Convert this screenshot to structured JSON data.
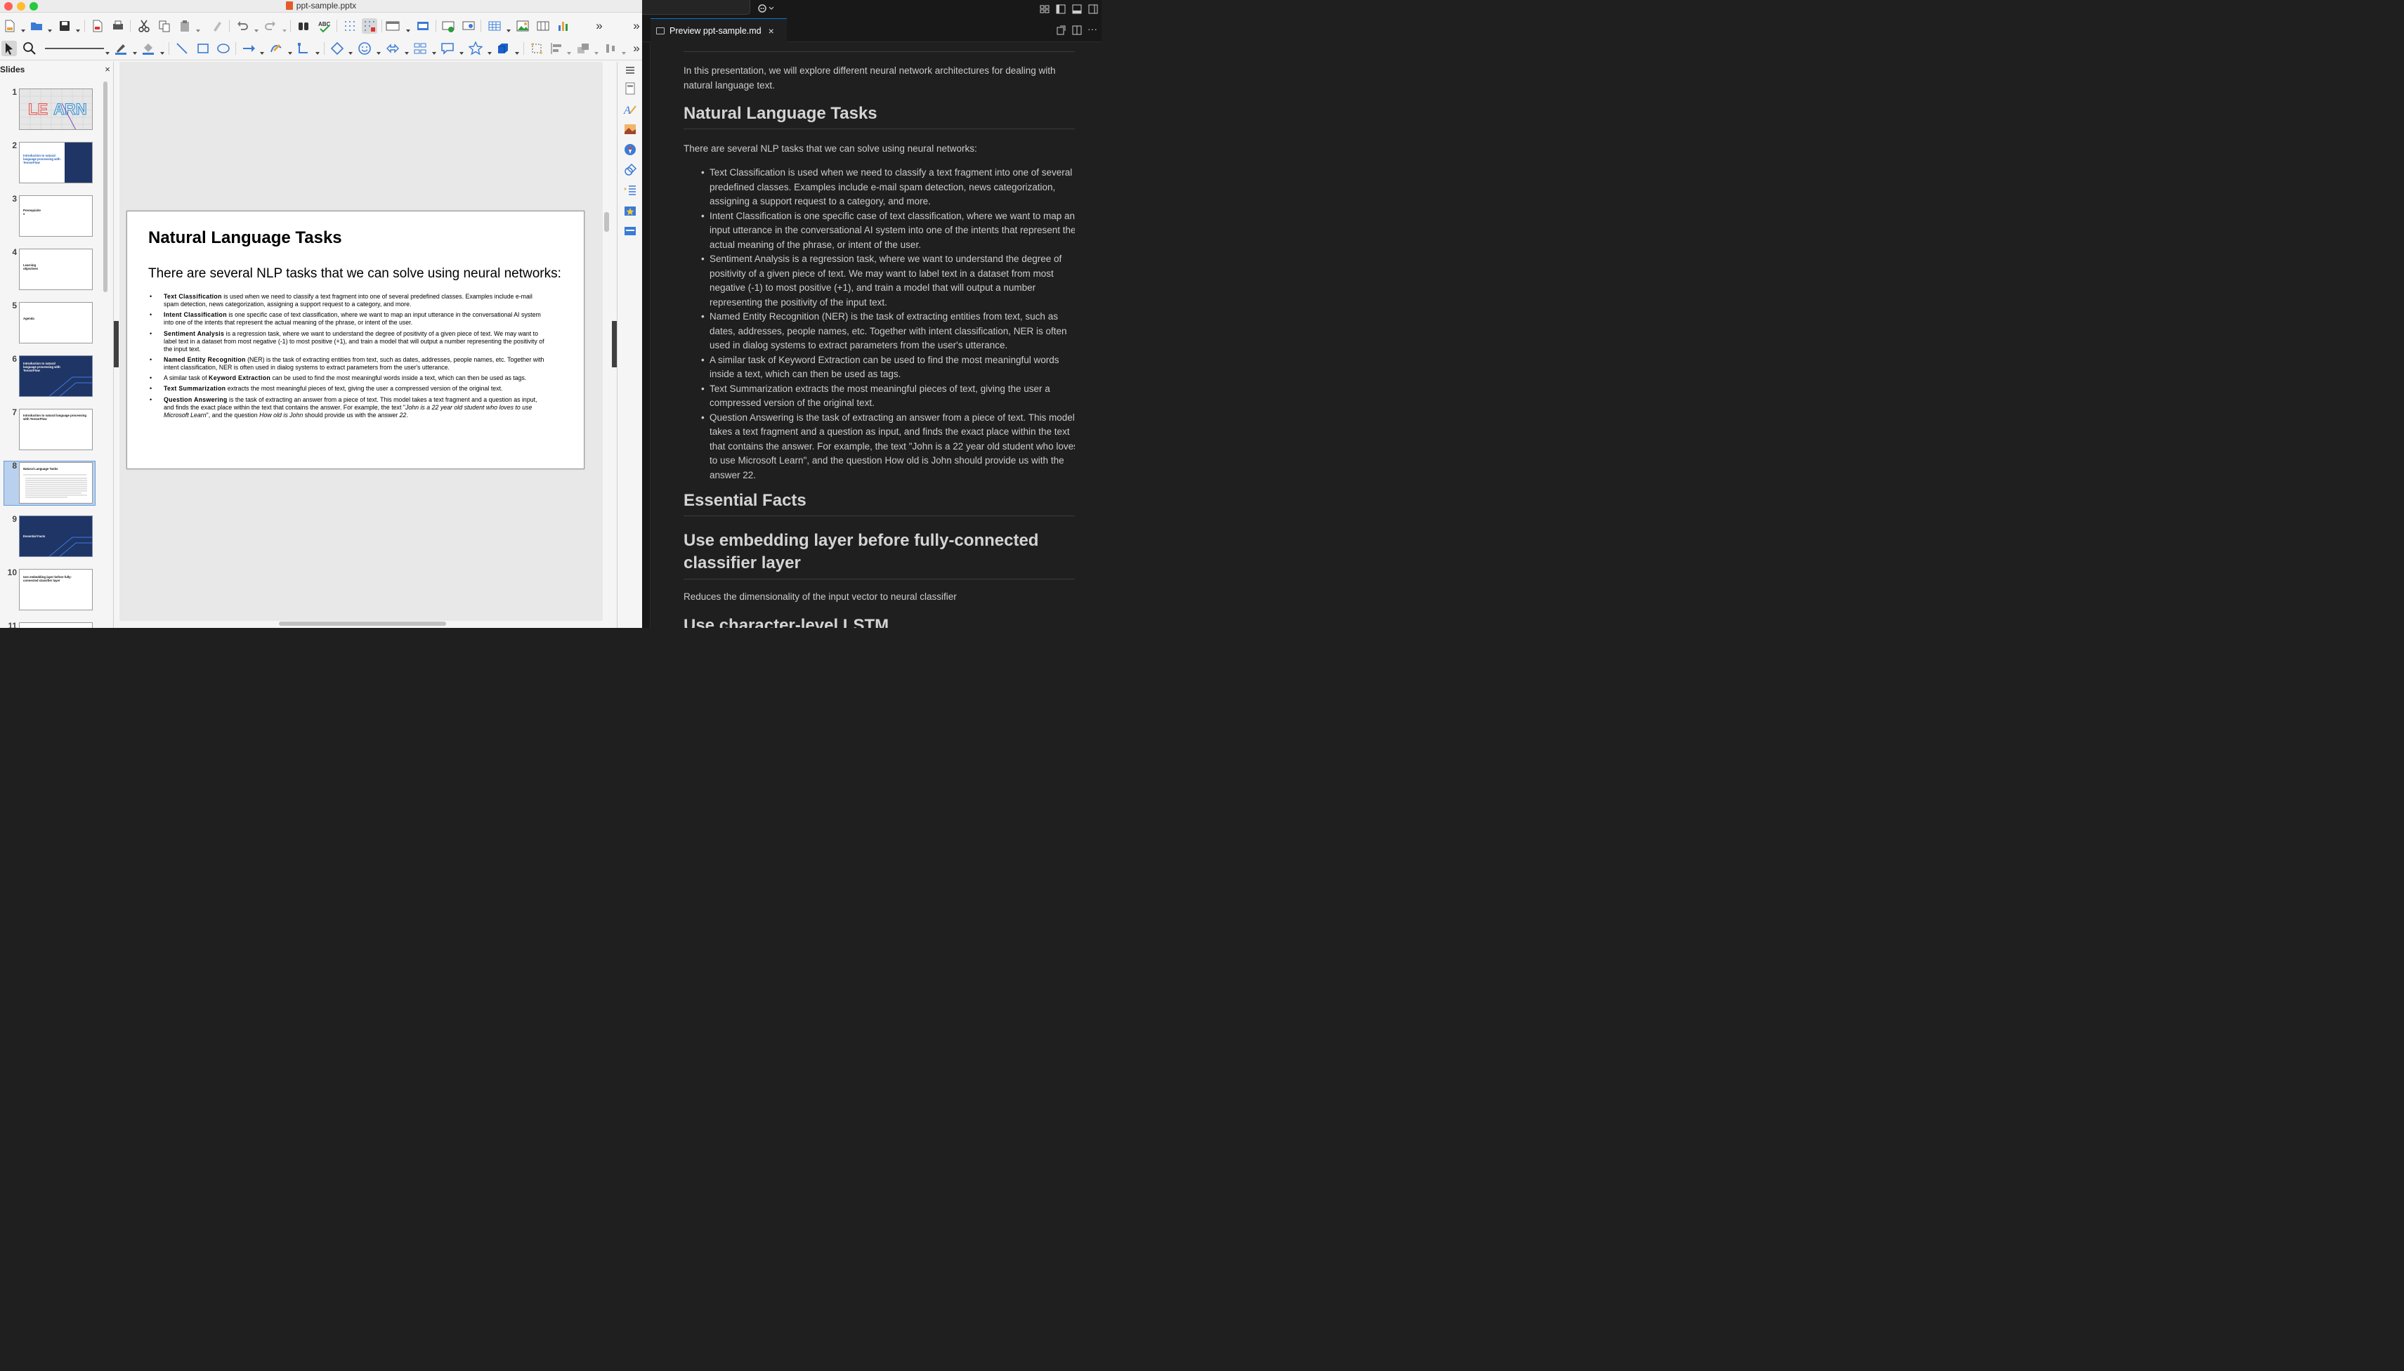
{
  "impress": {
    "window_title": "ppt-sample.pptx",
    "slides_pane_title": "Slides",
    "slides_pane_close": "×",
    "thumbnails": [
      {
        "num": "1",
        "title": "LEARN",
        "text": ""
      },
      {
        "num": "2",
        "title": "Introduction to natural language processing with TensorFlow",
        "text": ""
      },
      {
        "num": "3",
        "title": "Prerequisite s",
        "text": ""
      },
      {
        "num": "4",
        "title": "Learning objectives",
        "text": ""
      },
      {
        "num": "5",
        "title": "Agenda",
        "text": ""
      },
      {
        "num": "6",
        "title": "Introduction to natural language processing with TensorFlow",
        "text": ""
      },
      {
        "num": "7",
        "title": "Introduction to natural language processing with TensorFlow",
        "text": ""
      },
      {
        "num": "8",
        "title": "Natural Language Tasks",
        "text": ""
      },
      {
        "num": "9",
        "title": "Essential Facts",
        "text": ""
      },
      {
        "num": "10",
        "title": "Use embedding layer before fully-connected classifier layer",
        "text": ""
      },
      {
        "num": "11",
        "title": "",
        "text": ""
      }
    ],
    "slide": {
      "title": "Natural Language Tasks",
      "subtitle": "There are several NLP tasks that we can solve using neural networks:",
      "bullets": [
        {
          "bold": "Text Classification",
          "rest": " is used when we need to classify a text fragment into one of several predefined classes. Examples include e-mail spam detection, news categorization, assigning a support request to a category, and more."
        },
        {
          "bold": "Intent Classification",
          "rest": " is one specific case of text classification, where we want to map an input utterance in the conversational AI system into one of the intents that represent the actual meaning of the phrase, or intent of the user."
        },
        {
          "bold": "Sentiment Analysis",
          "rest": " is a regression task, where we want to understand the degree of positivity of a given piece of text. We may want to label text in a dataset from most negative (-1) to most positive (+1), and train a model that will output a number representing the positivity of the input text."
        },
        {
          "bold": "Named Entity Recognition",
          "rest": " (NER) is the task of extracting entities from text, such as dates, addresses, people names, etc. Together with intent classification, NER is often used in dialog systems to extract parameters from the user's utterance."
        },
        {
          "pre": "A similar task of ",
          "bold": "Keyword Extraction",
          "rest": " can be used to find the most meaningful words inside a text, which can then be used as tags."
        },
        {
          "bold": "Text Summarization",
          "rest": " extracts the most meaningful pieces of text, giving the user a compressed version of the original text."
        },
        {
          "bold": "Question Answering",
          "rest": " is the task of extracting an answer from a piece of text. This model takes a text fragment and a question as input, and finds the exact place within the text that contains the answer. For example, the text \"",
          "i1": "John is a 22 year old student who loves to use Microsoft Learn",
          "mid": "\", and the question ",
          "i2": "How old is John",
          "mid2": " should provide us with the answer ",
          "i3": "22",
          "end": "."
        }
      ]
    }
  },
  "vscode": {
    "tab_label": "Preview ppt-sample.md",
    "tab_close": "×",
    "preview": {
      "intro": "In this presentation, we will explore different neural network architectures for dealing with natural language text.",
      "h_nlt": "Natural Language Tasks",
      "p_nlt": "There are several NLP tasks that we can solve using neural networks:",
      "items": [
        "Text Classification is used when we need to classify a text fragment into one of several predefined classes. Examples include e-mail spam detection, news categorization, assigning a support request to a category, and more.",
        "Intent Classification is one specific case of text classification, where we want to map an input utterance in the conversational AI system into one of the intents that represent the actual meaning of the phrase, or intent of the user.",
        "Sentiment Analysis is a regression task, where we want to understand the degree of positivity of a given piece of text. We may want to label text in a dataset from most negative (-1) to most positive (+1), and train a model that will output a number representing the positivity of the input text.",
        "Named Entity Recognition (NER) is the task of extracting entities from text, such as dates, addresses, people names, etc. Together with intent classification, NER is often used in dialog systems to extract parameters from the user's utterance.",
        "A similar task of Keyword Extraction can be used to find the most meaningful words inside a text, which can then be used as tags.",
        "Text Summarization extracts the most meaningful pieces of text, giving the user a compressed version of the original text.",
        "Question Answering is the task of extracting an answer from a piece of text. This model takes a text fragment and a question as input, and finds the exact place within the text that contains the answer. For example, the text \"John is a 22 year old student who loves to use Microsoft Learn\", and the question How old is John should provide us with the answer 22."
      ],
      "h_facts": "Essential Facts",
      "h_embed": "Use embedding layer before fully-connected classifier layer",
      "p_embed": "Reduces the dimensionality of the input vector to neural classifier",
      "h_lstm": "Use character-level LSTM"
    }
  },
  "colors": {
    "accent_blue": "#0078d4",
    "selection": "#b9d1ee",
    "dark_slide": "#1f3566"
  }
}
